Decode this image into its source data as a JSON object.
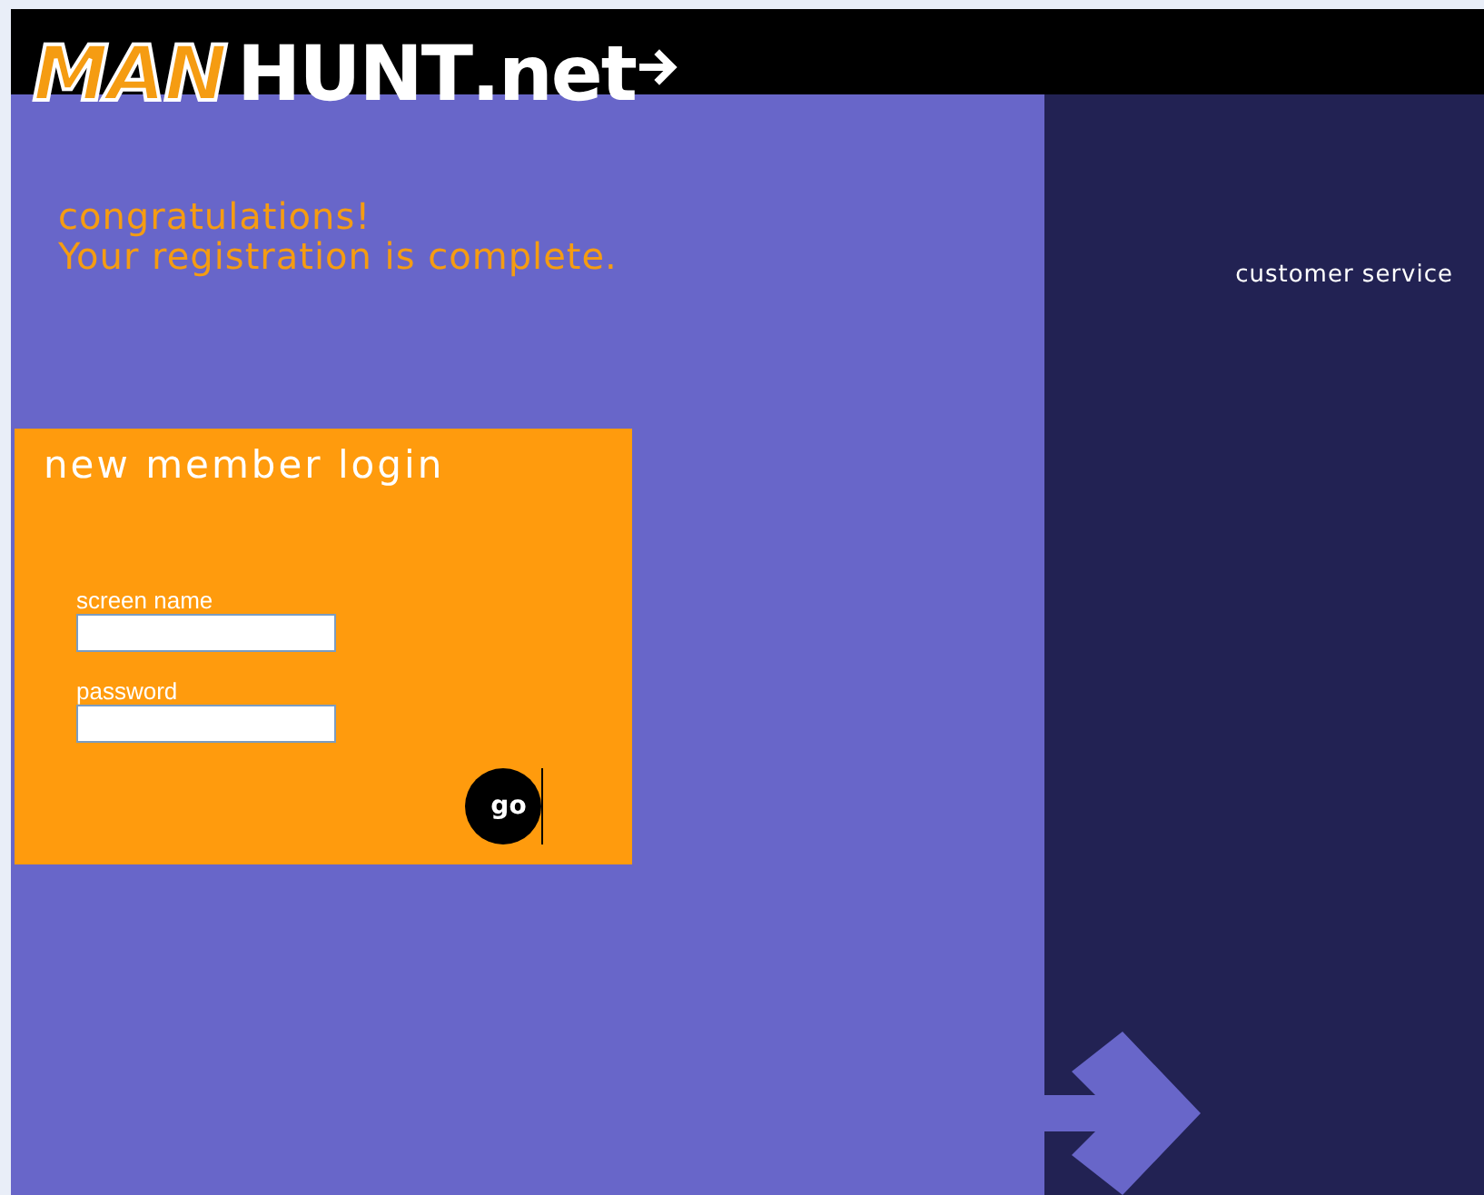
{
  "logo": {
    "part_1": "MAN",
    "part_2": "HUNT",
    "part_3": ".net"
  },
  "message": {
    "line_1": "congratulations!",
    "line_2": "Your registration is complete."
  },
  "login": {
    "title": "new member login",
    "fields": [
      {
        "label": "screen name"
      },
      {
        "label": "password"
      }
    ],
    "button": "go"
  },
  "sidebar": {
    "link": "customer service"
  }
}
